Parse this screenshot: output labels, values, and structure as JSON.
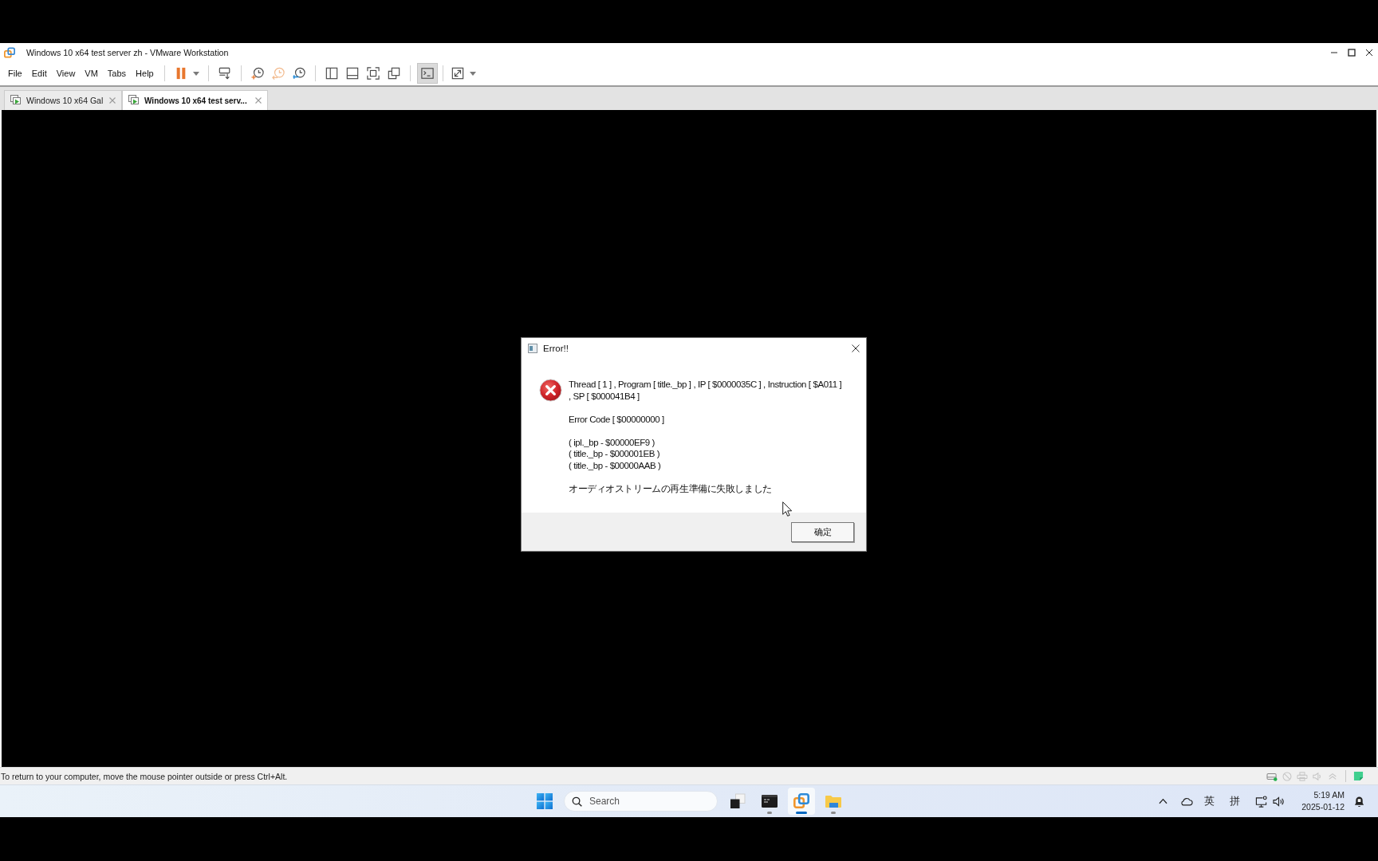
{
  "window": {
    "title": "Windows 10 x64 test server zh - VMware Workstation"
  },
  "menu": [
    "File",
    "Edit",
    "View",
    "VM",
    "Tabs",
    "Help"
  ],
  "toolbar": {
    "console_view_on": true
  },
  "tabs": [
    {
      "label": "Windows 10 x64 Gal",
      "selected": false
    },
    {
      "label": "Windows 10 x64 test serv...",
      "selected": true
    }
  ],
  "dialog": {
    "title": "Error!!",
    "paragraphs": [
      [
        "Thread [ 1 ] , Program [ title._bp ] , IP [ $0000035C ] , Instruction [ $A011 ]",
        ", SP [ $000041B4 ]"
      ],
      [
        "Error Code [ $00000000 ]"
      ],
      [
        "( ipl._bp - $00000EF9 )",
        "( title._bp - $000001EB )",
        "( title._bp - $00000AAB )"
      ],
      [
        "オーディオストリームの再生準備に失敗しました"
      ]
    ],
    "button": "确定"
  },
  "status_bar": {
    "text": "To return to your computer, move the mouse pointer outside or press Ctrl+Alt.",
    "devices": [
      {
        "active": true
      },
      {
        "active": false
      },
      {
        "active": false
      },
      {
        "active": false
      },
      {
        "active": false
      }
    ]
  },
  "taskbar": {
    "search": {
      "placeholder": "Search"
    },
    "apps": [
      {
        "running": false,
        "selected": false
      },
      {
        "running": true,
        "selected": false
      },
      {
        "running": true,
        "selected": true
      },
      {
        "running": true,
        "selected": false
      }
    ],
    "tray": {
      "input_indicators": [
        "英",
        "拼"
      ],
      "time": "5:19 AM",
      "date": "2025-01-12"
    }
  }
}
